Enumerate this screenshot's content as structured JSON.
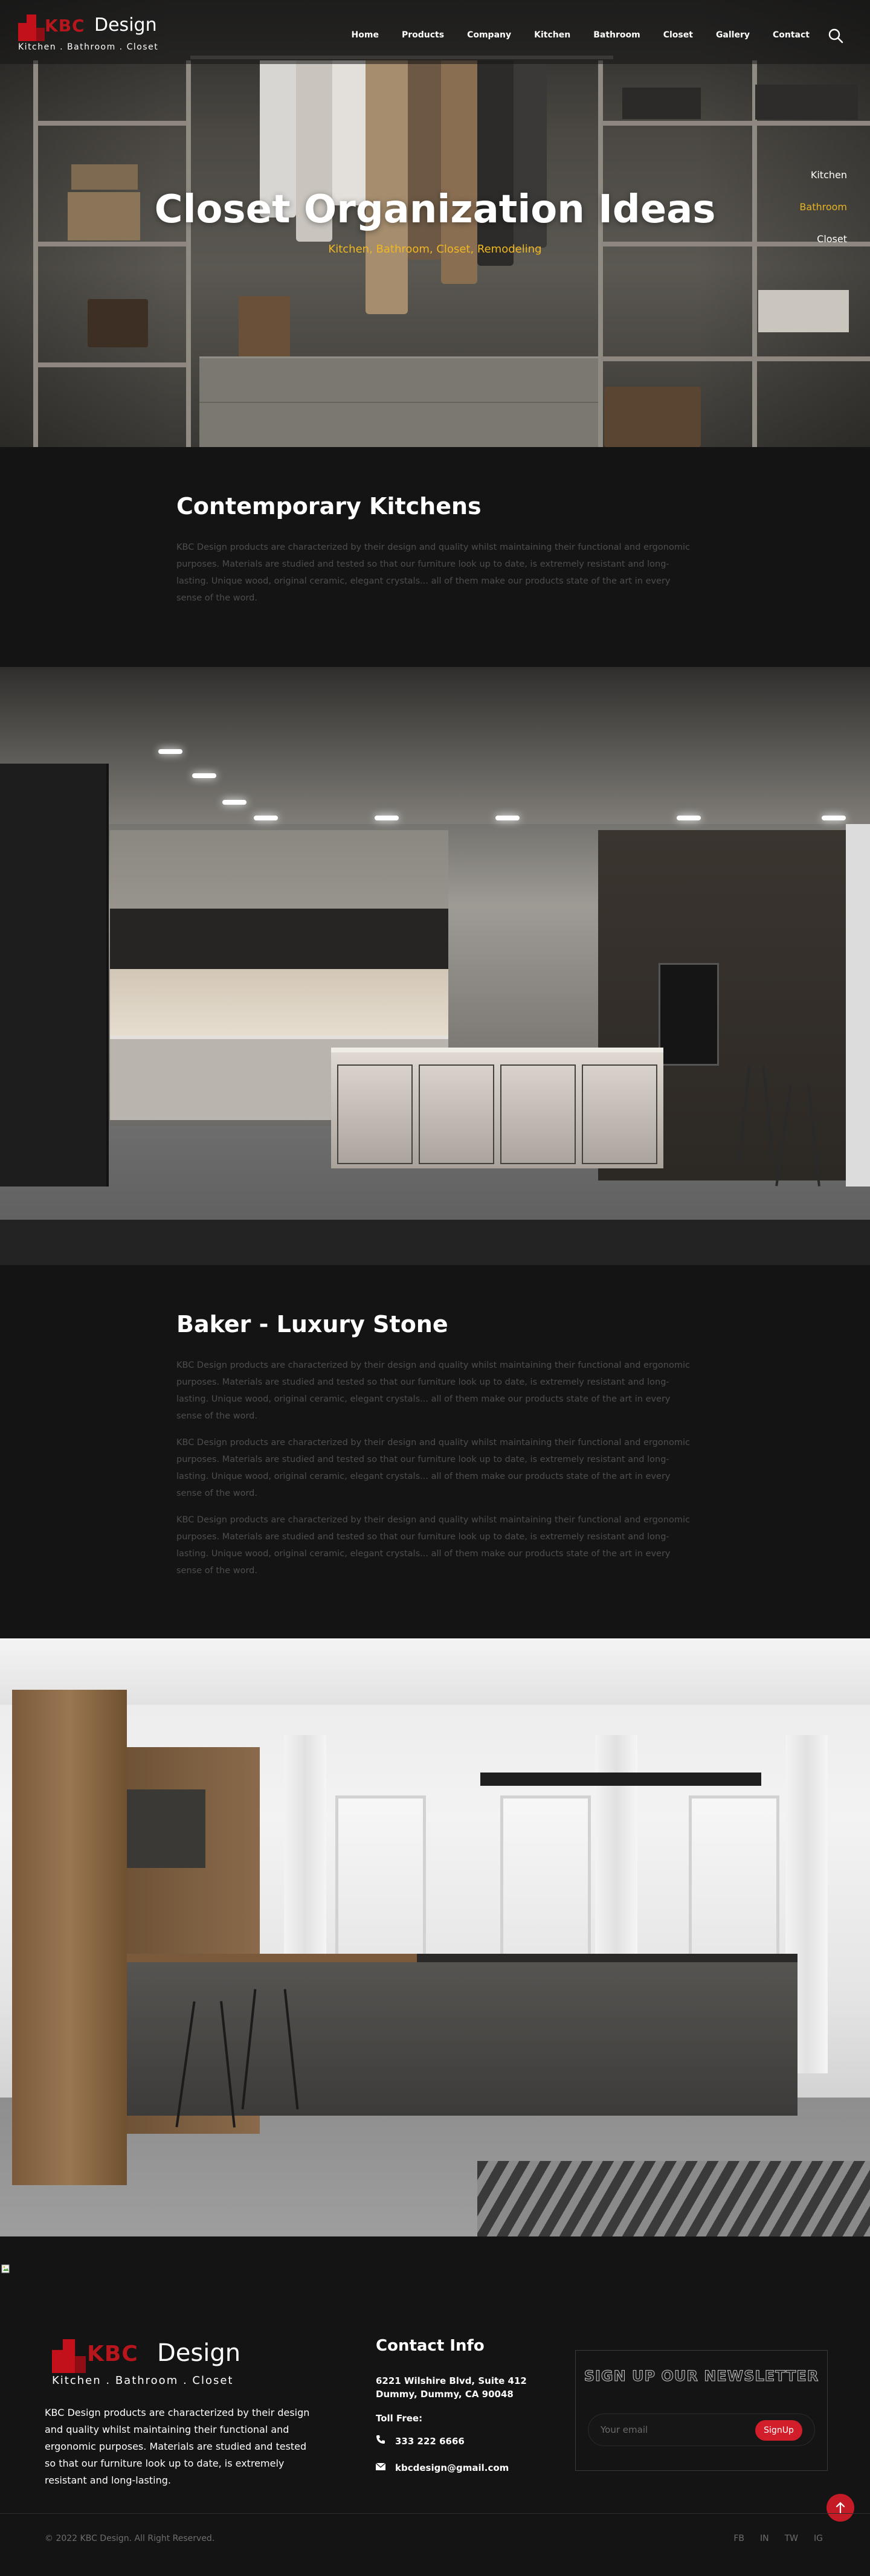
{
  "brand": {
    "logo_kbc": "KBC",
    "logo_design": "Design",
    "logo_tagline": "Kitchen . Bathroom . Closet",
    "accent_color": "#d21e2a",
    "highlight_color": "#f1b820"
  },
  "nav": {
    "items": [
      "Home",
      "Products",
      "Company",
      "Kitchen",
      "Bathroom",
      "Closet",
      "Gallery",
      "Contact"
    ],
    "search_icon": "search-icon"
  },
  "hero": {
    "title": "Closet Organization Ideas",
    "subtitle": "Kitchen, Bathroom, Closet, Remodeling",
    "side_menu": [
      "Kitchen",
      "Bathroom",
      "Closet"
    ],
    "side_menu_active": "Bathroom"
  },
  "section1": {
    "heading": "Contemporary Kitchens",
    "paragraph": "KBC Design products are characterized by their design and quality whilst maintaining their functional and ergonomic purposes. Materials are studied and tested so that our furniture look up to date, is extremely resistant and long-lasting. Unique wood, original ceramic, elegant crystals... all of them make our products state of the art in every sense of the word."
  },
  "section2": {
    "heading": "Baker - Luxury Stone",
    "paragraphs": [
      "KBC Design products are characterized by their design and quality whilst maintaining their functional and ergonomic purposes. Materials are studied and tested so that our furniture look up to date, is extremely resistant and long-lasting. Unique wood, original ceramic, elegant crystals... all of them make our products state of the art in every sense of the word.",
      "KBC Design products are characterized by their design and quality whilst maintaining their functional and ergonomic purposes. Materials are studied and tested so that our furniture look up to date, is extremely resistant and long-lasting. Unique wood, original ceramic, elegant crystals... all of them make our products state of the art in every sense of the word.",
      "KBC Design products are characterized by their design and quality whilst maintaining their functional and ergonomic purposes. Materials are studied and tested so that our furniture look up to date, is extremely resistant and long-lasting. Unique wood, original ceramic, elegant crystals... all of them make our products state of the art in every sense of the word."
    ]
  },
  "footer": {
    "about": "KBC Design products are characterized by their design and quality whilst maintaining their functional and ergonomic purposes. Materials are studied and tested so that our furniture look up to date, is extremely resistant and long-lasting.",
    "contact_title": "Contact Info",
    "address_line1": "6221 Wilshire Blvd, Suite 412",
    "address_line2": "Dummy, Dummy, CA 90048",
    "toll_free_label": "Toll Free:",
    "phone": "333 222 6666",
    "email": "kbcdesign@gmail.com",
    "newsletter_title": "SIGN UP OUR NEWSLETTER",
    "email_placeholder": "Your email",
    "signup_label": "SignUp",
    "copyright": "© 2022 KBC Design. All Right Reserved.",
    "socials": [
      "FB",
      "IN",
      "TW",
      "IG"
    ]
  }
}
